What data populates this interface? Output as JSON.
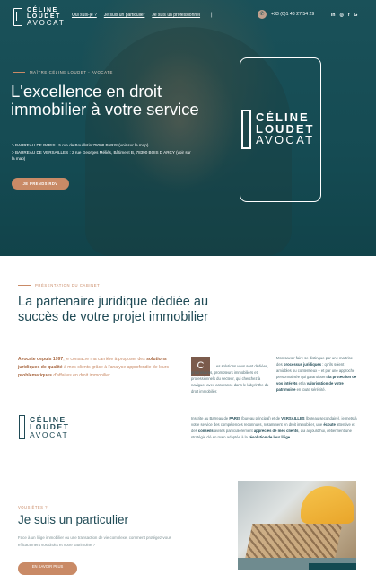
{
  "header": {
    "logo_line1": "CÉLINE",
    "logo_line2": "LOUDET",
    "logo_line3": "AVOCAT",
    "nav": [
      "Qui suis-je ?",
      "Je suis un particulier",
      "Je suis un professionnel"
    ],
    "nav_sep": "|",
    "phone": "+33 (0)1 43 27 54 29",
    "socials": [
      "in",
      "◎",
      "f",
      "G"
    ]
  },
  "hero": {
    "overline": "MAÎTRE CÉLINE LOUDET - AVOCATE",
    "title": "L'excellence en droit immobilier à votre service",
    "addr1": "> BARREAU DE PARIS : 5 rue de Bouillotin 75008 PARIS (voir sur la map)",
    "addr2": "> BARREAU DE VERSAILLES : 2 rue Georges Méliès, Bâtiment B, 78390 BOIS D ARCY (voir sur la map)",
    "cta": "JE PRENDS RDV",
    "frame_line1": "CÉLINE",
    "frame_line2": "LOUDET",
    "frame_line3": "AVOCAT"
  },
  "presentation": {
    "overline": "PRÉSENTATION DU CABINET",
    "title": "La partenaire juridique dédiée au succès de votre projet immobilier",
    "intro_a": "Avocate depuis 1997",
    "intro_b": ", je consacre ma carrière à proposer des ",
    "intro_c": "solutions juridiques de qualité",
    "intro_d": " à mes clients grâce à l'analyse approfondie de leurs ",
    "intro_e": "problématiques",
    "intro_f": " d'affaires en droit immobilier.",
    "dropcap": "C",
    "col1": "es solutions vous sont dédiées, propriétaires, promoteurs immobiliers et professionnels du secteur, qui cherchez à naviguer avec assurance dans le labyrinthe du droit immobilier.",
    "col2_a": "Mon savoir-faire se distingue par une maîtrise des ",
    "col2_b": "processus juridiques",
    "col2_c": " : qu'ils soient amiables ou contentieux – et par une approche personnalisée qui garantissent ",
    "col2_d": "la protection de vos intérêts",
    "col2_e": " et la ",
    "col2_f": "valorisation de votre patrimoine",
    "col2_g": " en toute sérénité.",
    "full_a": "Inscrite au Barreau de ",
    "full_b": "PARIS",
    "full_c": " (bureau principal) et de ",
    "full_d": "VERSAILLES",
    "full_e": " (bureau secondaire), je mets à votre service des compétences reconnues, notamment en droit immobilier, une ",
    "full_f": "écoute",
    "full_g": " attentive et des ",
    "full_h": "conseils",
    "full_i": " avisés particulièrement ",
    "full_j": "appréciés de mes clients",
    "full_k": ", qui aujourd'hui, détiennent une stratégie clé en main adaptée à la ",
    "full_l": "résolution de leur litige",
    "full_m": ".",
    "logo_line1": "CÉLINE",
    "logo_line2": "LOUDET",
    "logo_line3": "AVOCAT"
  },
  "particulier": {
    "overline": "VOUS ÊTES ?",
    "title": "Je suis un particulier",
    "text": "Face à un litige immobilier ou une transaction de vie complexe, comment protégez-vous efficacement vos droits et votre patrimoine ?",
    "button": "EN SAVOIR PLUS"
  }
}
